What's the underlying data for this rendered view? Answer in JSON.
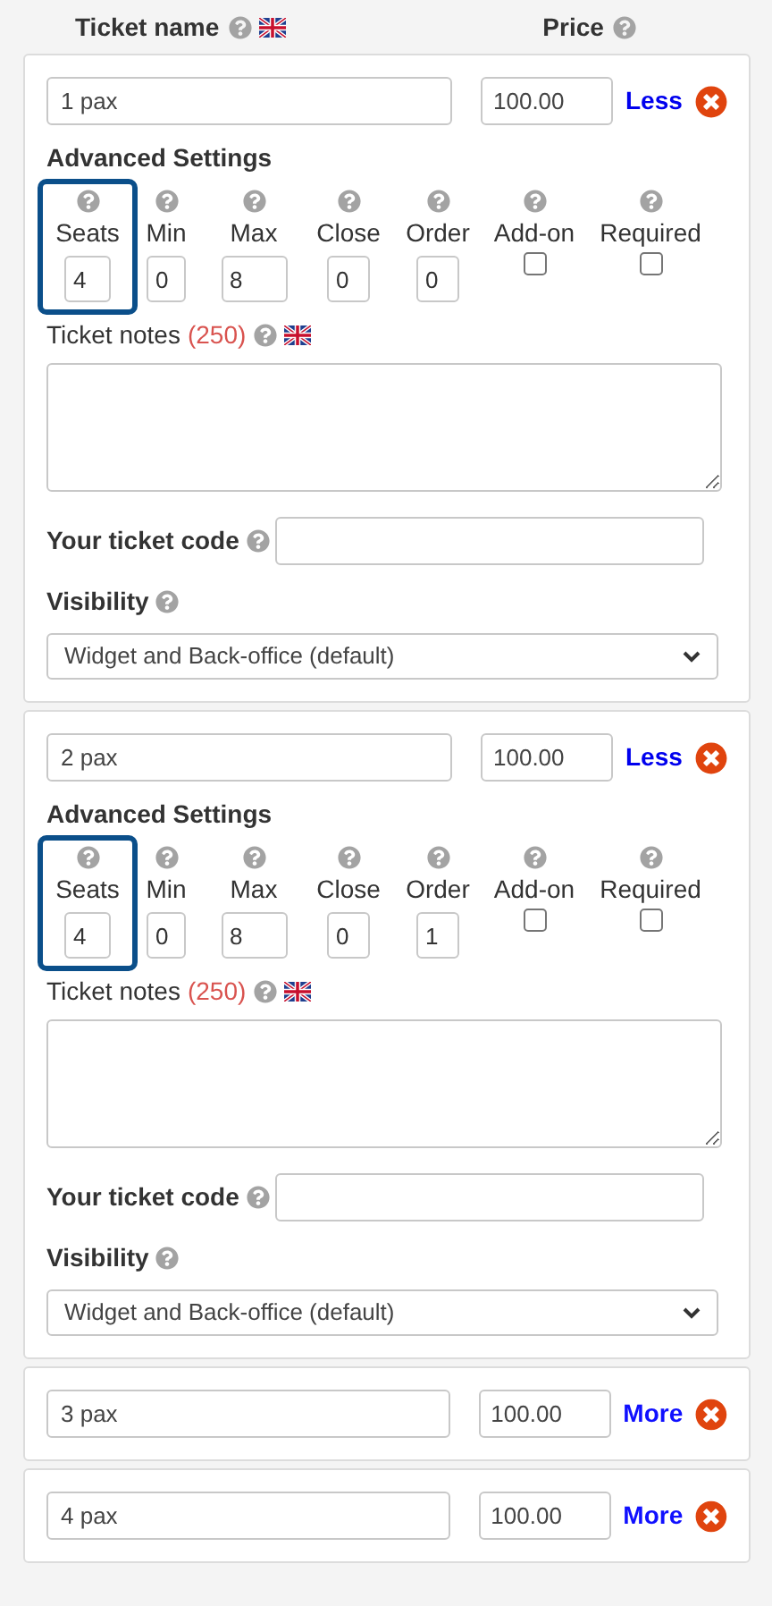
{
  "header": {
    "name_label": "Ticket name",
    "price_label": "Price"
  },
  "tickets": [
    {
      "name": "1 pax",
      "price": "100.00",
      "toggle": "Less",
      "expanded": true,
      "advanced": {
        "title": "Advanced Settings",
        "fields": [
          {
            "kind": "number",
            "label": "Seats",
            "value": "4",
            "highlighted": true
          },
          {
            "kind": "number",
            "label": "Min",
            "value": "0",
            "highlighted": false
          },
          {
            "kind": "number",
            "label": "Max",
            "value": "8",
            "highlighted": false
          },
          {
            "kind": "number",
            "label": "Close",
            "value": "0",
            "highlighted": false
          },
          {
            "kind": "number",
            "label": "Order",
            "value": "0",
            "highlighted": false
          },
          {
            "kind": "checkbox",
            "label": "Add-on",
            "checked": false,
            "highlighted": false
          },
          {
            "kind": "checkbox",
            "label": "Required",
            "checked": false,
            "highlighted": false
          }
        ],
        "notes_label": "Ticket notes",
        "notes_count": "(250)",
        "code_label": "Your ticket code",
        "visibility_label": "Visibility",
        "visibility_value": "Widget and Back-office (default)"
      }
    },
    {
      "name": "2 pax",
      "price": "100.00",
      "toggle": "Less",
      "expanded": true,
      "advanced": {
        "title": "Advanced Settings",
        "fields": [
          {
            "kind": "number",
            "label": "Seats",
            "value": "4",
            "highlighted": true
          },
          {
            "kind": "number",
            "label": "Min",
            "value": "0",
            "highlighted": false
          },
          {
            "kind": "number",
            "label": "Max",
            "value": "8",
            "highlighted": false
          },
          {
            "kind": "number",
            "label": "Close",
            "value": "0",
            "highlighted": false
          },
          {
            "kind": "number",
            "label": "Order",
            "value": "1",
            "highlighted": false
          },
          {
            "kind": "checkbox",
            "label": "Add-on",
            "checked": false,
            "highlighted": false
          },
          {
            "kind": "checkbox",
            "label": "Required",
            "checked": false,
            "highlighted": false
          }
        ],
        "notes_label": "Ticket notes",
        "notes_count": "(250)",
        "code_label": "Your ticket code",
        "visibility_label": "Visibility",
        "visibility_value": "Widget and Back-office (default)"
      }
    },
    {
      "name": "3 pax",
      "price": "100.00",
      "toggle": "More",
      "expanded": false
    },
    {
      "name": "4 pax",
      "price": "100.00",
      "toggle": "More",
      "expanded": false
    }
  ]
}
